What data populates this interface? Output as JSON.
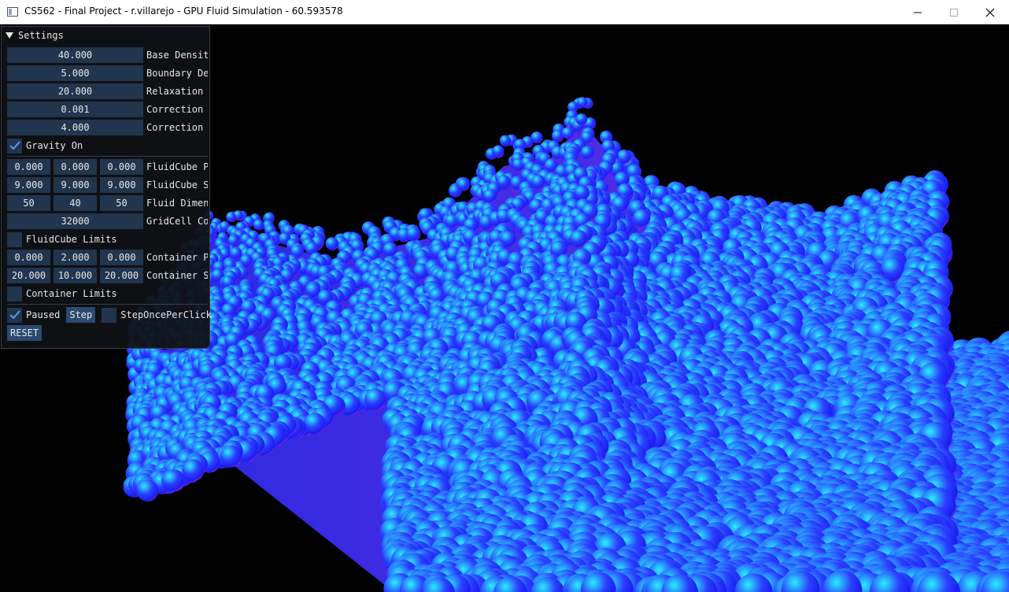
{
  "window": {
    "title": "CS562 - Final Project - r.villarejo - GPU Fluid Simulation - 60.593578",
    "minimize_label": "—",
    "maximize_label": "☐",
    "close_label": "✕"
  },
  "panel": {
    "title": "Settings",
    "fields": [
      {
        "value": "40.000",
        "label": "Base Densit"
      },
      {
        "value": "5.000",
        "label": "Boundary De"
      },
      {
        "value": "20.000",
        "label": "Relaxation"
      },
      {
        "value": "0.001",
        "label": "Correction"
      },
      {
        "value": "4.000",
        "label": "Correction"
      }
    ],
    "gravity": {
      "label": "Gravity On",
      "checked": true
    },
    "fluidcube_pos": {
      "values": [
        "0.000",
        "0.000",
        "0.000"
      ],
      "label": "FluidCube P"
    },
    "fluidcube_size": {
      "values": [
        "9.000",
        "9.000",
        "9.000"
      ],
      "label": "FluidCube S"
    },
    "fluid_dims": {
      "values": [
        "50",
        "40",
        "50"
      ],
      "label": "Fluid Dimen"
    },
    "gridcell": {
      "value": "32000",
      "label": "GridCell Co"
    },
    "fluidcube_limits": {
      "label": "FluidCube Limits",
      "checked": false
    },
    "container_pos": {
      "values": [
        "0.000",
        "2.000",
        "0.000"
      ],
      "label": "Container P"
    },
    "container_size": {
      "values": [
        "20.000",
        "10.000",
        "20.000"
      ],
      "label": "Container S"
    },
    "container_limits": {
      "label": "Container Limits",
      "checked": false
    },
    "paused": {
      "label": "Paused",
      "checked": true
    },
    "step_button": "Step",
    "step_once": {
      "label": "StepOncePerClick",
      "checked": false
    },
    "reset_button": "RESET"
  },
  "colors": {
    "accent": "#22354f",
    "check": "#4f95e8",
    "particle_blue": "#1e2cff",
    "particle_cyan": "#21e3ff",
    "particle_magenta": "#ff2ed6"
  }
}
